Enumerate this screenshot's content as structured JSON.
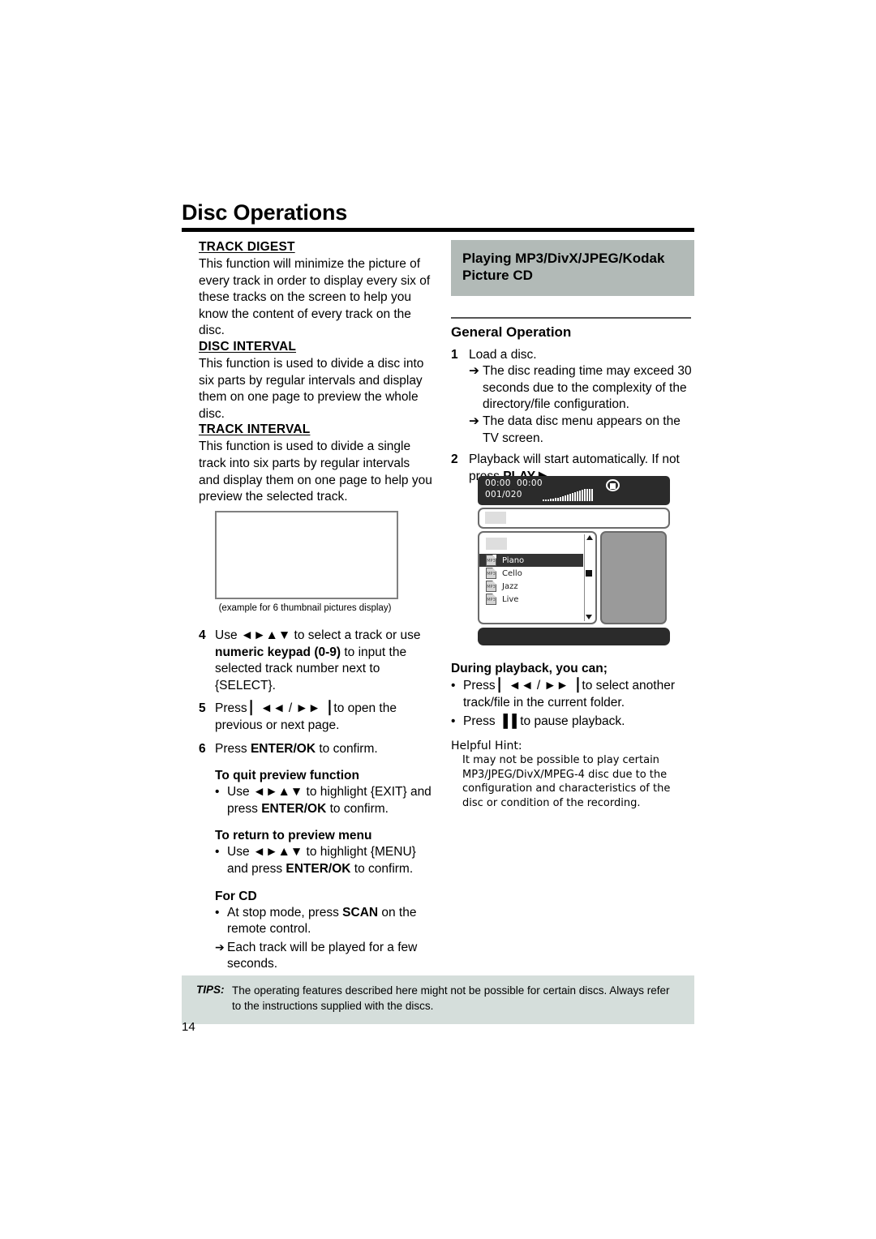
{
  "page": {
    "title": "Disc Operations",
    "number": "14"
  },
  "left_column": {
    "sections": [
      {
        "heading": "TRACK DIGEST",
        "body": "This function will minimize the picture of every track in order to display every six of these tracks on the screen to help you know the content of every track on the disc."
      },
      {
        "heading": "DISC INTERVAL",
        "body": "This function is used to divide a disc into six parts by regular intervals and display them on one page to preview the whole disc."
      },
      {
        "heading": "TRACK INTERVAL",
        "body": "This function is used to divide a single track into six parts by regular intervals and display them on one page to help you preview the selected track."
      }
    ],
    "figure_caption": "(example for 6 thumbnail pictures display)",
    "steps": [
      {
        "num": "4",
        "text_1": "Use ",
        "keys_1": "◄►▲▼",
        "text_2": " to select a track or use ",
        "bold_1": "numeric keypad (0-9)",
        "text_3": " to input the selected track number next to {SELECT}."
      },
      {
        "num": "5",
        "text_1": "Press ",
        "keys_1": "▏◄◄",
        "text_2": " / ",
        "keys_2": "►►▕",
        "text_3": " to open the previous or next page."
      },
      {
        "num": "6",
        "text_1": "Press ",
        "bold_1": "ENTER/OK",
        "text_2": " to confirm."
      }
    ],
    "quit_preview": {
      "heading": "To quit preview function",
      "bullet": "•",
      "text_1": "Use ",
      "keys_1": "◄►▲▼",
      "text_2": " to highlight {EXIT} and press ",
      "bold_1": "ENTER/OK",
      "text_3": " to confirm."
    },
    "return_menu": {
      "heading": "To return to preview menu",
      "bullet": "•",
      "text_1": "Use ",
      "keys_1": "◄►▲▼",
      "text_2": " to highlight {MENU} and press ",
      "bold_1": "ENTER/OK",
      "text_3": " to confirm."
    },
    "for_cd": {
      "heading": "For CD",
      "bullet": "•",
      "text_1": "At stop mode, press ",
      "bold_1": "SCAN",
      "text_2": " on the remote control.",
      "arrow": "➔",
      "arrow_text": "Each track will be played for a few seconds."
    }
  },
  "right_column": {
    "band_title": "Playing MP3/DivX/JPEG/Kodak Picture CD",
    "general_operation": "General Operation",
    "step1": {
      "num": "1",
      "text": "Load a disc.",
      "arrow": "➔",
      "arrow_items": [
        "The disc reading time may exceed 30 seconds due to the complexity of the directory/file configuration.",
        "The data disc menu appears on the TV screen."
      ]
    },
    "step2": {
      "num": "2",
      "text_1": "Playback will start automatically. If not press ",
      "bold_1": "PLAY",
      "keys_1": " ▶",
      "text_2": "."
    },
    "during_playback": {
      "heading": "During playback, you can;",
      "bullet": "•",
      "items": [
        {
          "text_1": "Press ",
          "keys_1": "▏◄◄",
          "text_2": " / ",
          "keys_2": "►►▕",
          "text_3": " to select another track/file in the current folder."
        },
        {
          "text_1": "Press ",
          "keys_1": "▐▐",
          "text_2": " to pause playback."
        }
      ]
    },
    "helpful_hint": {
      "title": "Helpful Hint:",
      "body": "It may not be possible to play certain MP3/JPEG/DivX/MPEG-4 disc due to the configuration and characteristics of the disc or condition of the recording."
    }
  },
  "tv_screen": {
    "time_elapsed": "00:00",
    "time_total": "00:00",
    "track_counter": "001/020",
    "stop_icon": "stop-icon",
    "files": [
      {
        "type": "MP3",
        "name": "Piano",
        "selected": true
      },
      {
        "type": "MP3",
        "name": "Cello",
        "selected": false
      },
      {
        "type": "MP3",
        "name": "Jazz",
        "selected": false
      },
      {
        "type": "MP3",
        "name": "Live",
        "selected": false
      }
    ]
  },
  "tips": {
    "label": "TIPS:",
    "text": "The operating features described here might not be possible for certain discs. Always refer to the instructions supplied with the discs."
  },
  "colors": {
    "band_gray": "#b2bab7",
    "tips_green": "#d5dedb",
    "dark_ui": "#2b2b2b",
    "preview_gray": "#9a9a9a"
  }
}
